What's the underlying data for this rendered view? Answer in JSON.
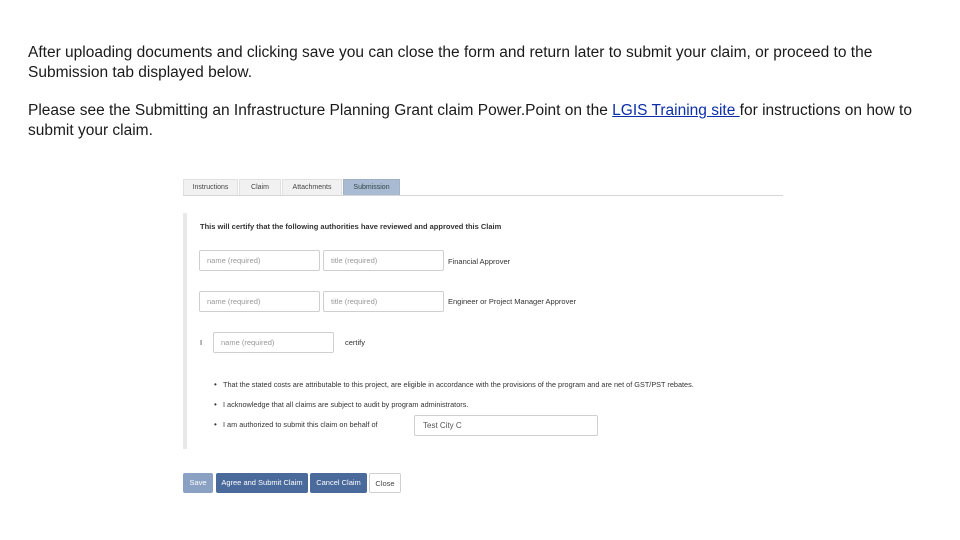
{
  "intro": {
    "paragraph1": "After uploading documents and clicking save you can close the form and return later to submit your claim, or proceed to the Submission tab displayed below.",
    "paragraph2_before": "Please see the Submitting an Infrastructure Planning Grant claim Power.Point on the ",
    "paragraph2_link": "LGIS Training site ",
    "paragraph2_after": "for instructions on how to submit your claim."
  },
  "tabs": [
    {
      "label": "Instructions"
    },
    {
      "label": "Claim"
    },
    {
      "label": "Attachments"
    },
    {
      "label": "Submission",
      "active": true
    }
  ],
  "form": {
    "certify_heading": "This will certify that the following authorities have reviewed and approved this Claim",
    "financial_name_placeholder": "name (required)",
    "financial_title_placeholder": "title (required)",
    "financial_label": "Financial Approver",
    "engineer_name_placeholder": "name (required)",
    "engineer_title_placeholder": "title (required)",
    "engineer_label": "Engineer or Project Manager Approver",
    "i_label": "I",
    "certifier_name_placeholder": "name (required)",
    "certify_label": "certify",
    "bullets": [
      "That the stated costs are attributable to this project, are eligible in accordance with the provisions of the program and are net of GST/PST rebates.",
      "I acknowledge that all claims are subject to audit by program administrators.",
      "I am authorized to submit this claim on behalf of"
    ],
    "organization_value": "Test City C"
  },
  "buttons": {
    "save": "Save",
    "agree_submit": "Agree and Submit Claim",
    "cancel_claim": "Cancel Claim",
    "close": "Close"
  },
  "colors": {
    "link": "#0b2fa8",
    "active_tab": "#a9bbd3",
    "primary_button": "#4a6a9c",
    "save_button": "#8aa1c3"
  }
}
